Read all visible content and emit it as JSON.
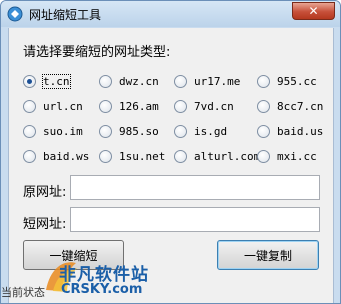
{
  "window": {
    "title": "网址缩短工具",
    "close_glyph": "✕"
  },
  "prompt": "请选择要缩短的网址类型:",
  "services": [
    {
      "label": "t.cn",
      "checked": true
    },
    {
      "label": "dwz.cn",
      "checked": false
    },
    {
      "label": "ur17.me",
      "checked": false
    },
    {
      "label": "955.cc",
      "checked": false
    },
    {
      "label": "url.cn",
      "checked": false
    },
    {
      "label": "126.am",
      "checked": false
    },
    {
      "label": "7vd.cn",
      "checked": false
    },
    {
      "label": "8cc7.cn",
      "checked": false
    },
    {
      "label": "suo.im",
      "checked": false
    },
    {
      "label": "985.so",
      "checked": false
    },
    {
      "label": "is.gd",
      "checked": false
    },
    {
      "label": "baid.us",
      "checked": false
    },
    {
      "label": "baid.ws",
      "checked": false
    },
    {
      "label": "1su.net",
      "checked": false
    },
    {
      "label": "alturl.com",
      "checked": false
    },
    {
      "label": "mxi.cc",
      "checked": false
    }
  ],
  "original_url": {
    "label": "原网址:",
    "value": ""
  },
  "short_url": {
    "label": "短网址:",
    "value": ""
  },
  "buttons": {
    "shorten": "一键缩短",
    "copy": "一键复制"
  },
  "watermark": {
    "brand": "非凡软件站",
    "domain": "CRSKY.com"
  },
  "footer_text": "当前状态"
}
